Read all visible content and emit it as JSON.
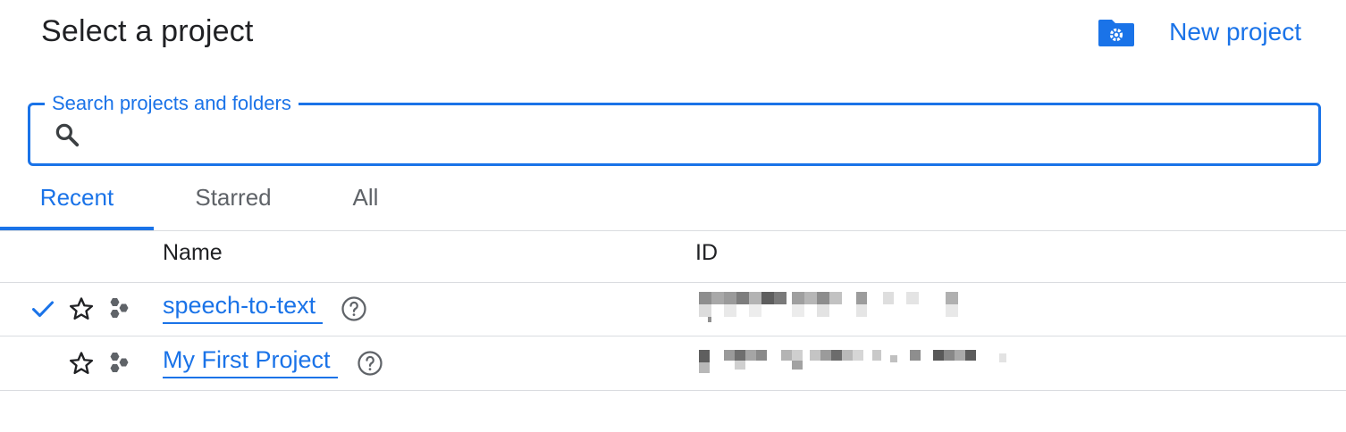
{
  "header": {
    "title": "Select a project",
    "new_project_label": "New project",
    "new_project_icon": "folder-settings-icon"
  },
  "search": {
    "legend": "Search projects and folders",
    "value": "",
    "placeholder": "",
    "icon": "search-icon"
  },
  "tabs": [
    {
      "label": "Recent",
      "active": true
    },
    {
      "label": "Starred",
      "active": false
    },
    {
      "label": "All",
      "active": false
    }
  ],
  "table": {
    "columns": [
      "Name",
      "ID"
    ],
    "rows": [
      {
        "name": "speech-to-text",
        "selected": true,
        "starred": false
      },
      {
        "name": "My First Project",
        "selected": false,
        "starred": false
      }
    ]
  },
  "colors": {
    "accent": "#1a73e8",
    "text": "#202124",
    "muted": "#5f6368",
    "divider": "#dadce0"
  }
}
